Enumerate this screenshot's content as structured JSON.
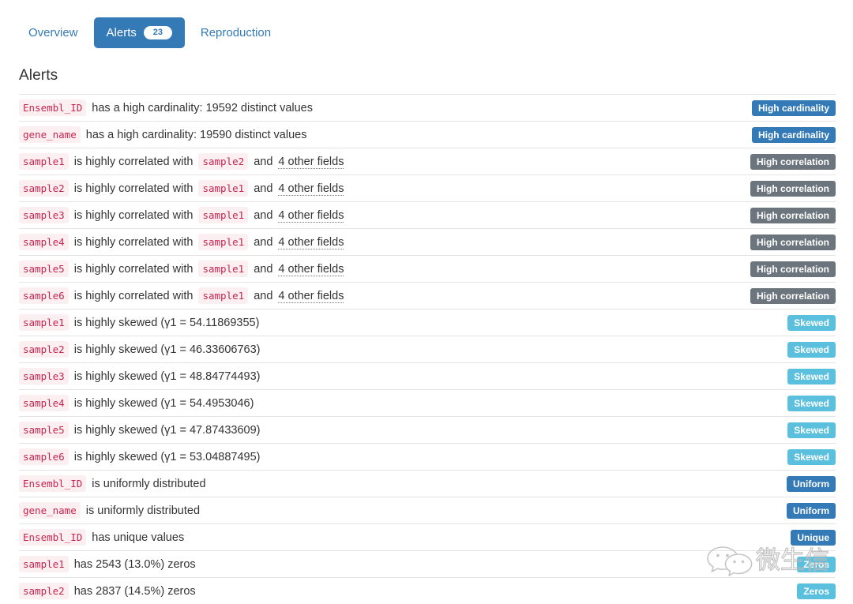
{
  "tabs": [
    {
      "label": "Overview",
      "active": false,
      "count": null
    },
    {
      "label": "Alerts",
      "active": true,
      "count": "23"
    },
    {
      "label": "Reproduction",
      "active": false,
      "count": null
    }
  ],
  "section": {
    "title": "Alerts"
  },
  "colors": {
    "accent": "#337ab7",
    "badge_primary": "#337ab7",
    "badge_secondary": "#6c757d",
    "badge_info": "#5bc0de",
    "code_text": "#c7254e",
    "code_bg": "#fbeff2",
    "row_border": "#e4e4e4"
  },
  "alerts": [
    {
      "parts": [
        {
          "type": "code",
          "text": "Ensembl_ID"
        },
        {
          "type": "text",
          "text": "has a high cardinality: 19592 distinct values"
        }
      ],
      "badge": {
        "label": "High cardinality",
        "style": "badge-primary"
      }
    },
    {
      "parts": [
        {
          "type": "code",
          "text": "gene_name"
        },
        {
          "type": "text",
          "text": "has a high cardinality: 19590 distinct values"
        }
      ],
      "badge": {
        "label": "High cardinality",
        "style": "badge-primary"
      }
    },
    {
      "parts": [
        {
          "type": "code",
          "text": "sample1"
        },
        {
          "type": "text",
          "text": "is highly correlated with"
        },
        {
          "type": "code",
          "text": "sample2"
        },
        {
          "type": "text",
          "text": "and"
        },
        {
          "type": "abbr",
          "text": "4 other fields"
        }
      ],
      "badge": {
        "label": "High correlation",
        "style": "badge-secondary"
      }
    },
    {
      "parts": [
        {
          "type": "code",
          "text": "sample2"
        },
        {
          "type": "text",
          "text": "is highly correlated with"
        },
        {
          "type": "code",
          "text": "sample1"
        },
        {
          "type": "text",
          "text": "and"
        },
        {
          "type": "abbr",
          "text": "4 other fields"
        }
      ],
      "badge": {
        "label": "High correlation",
        "style": "badge-secondary"
      }
    },
    {
      "parts": [
        {
          "type": "code",
          "text": "sample3"
        },
        {
          "type": "text",
          "text": "is highly correlated with"
        },
        {
          "type": "code",
          "text": "sample1"
        },
        {
          "type": "text",
          "text": "and"
        },
        {
          "type": "abbr",
          "text": "4 other fields"
        }
      ],
      "badge": {
        "label": "High correlation",
        "style": "badge-secondary"
      }
    },
    {
      "parts": [
        {
          "type": "code",
          "text": "sample4"
        },
        {
          "type": "text",
          "text": "is highly correlated with"
        },
        {
          "type": "code",
          "text": "sample1"
        },
        {
          "type": "text",
          "text": "and"
        },
        {
          "type": "abbr",
          "text": "4 other fields"
        }
      ],
      "badge": {
        "label": "High correlation",
        "style": "badge-secondary"
      }
    },
    {
      "parts": [
        {
          "type": "code",
          "text": "sample5"
        },
        {
          "type": "text",
          "text": "is highly correlated with"
        },
        {
          "type": "code",
          "text": "sample1"
        },
        {
          "type": "text",
          "text": "and"
        },
        {
          "type": "abbr",
          "text": "4 other fields"
        }
      ],
      "badge": {
        "label": "High correlation",
        "style": "badge-secondary"
      }
    },
    {
      "parts": [
        {
          "type": "code",
          "text": "sample6"
        },
        {
          "type": "text",
          "text": "is highly correlated with"
        },
        {
          "type": "code",
          "text": "sample1"
        },
        {
          "type": "text",
          "text": "and"
        },
        {
          "type": "abbr",
          "text": "4 other fields"
        }
      ],
      "badge": {
        "label": "High correlation",
        "style": "badge-secondary"
      }
    },
    {
      "parts": [
        {
          "type": "code",
          "text": "sample1"
        },
        {
          "type": "text",
          "text": "is highly skewed (γ1 = 54.11869355)"
        }
      ],
      "badge": {
        "label": "Skewed",
        "style": "badge-info"
      }
    },
    {
      "parts": [
        {
          "type": "code",
          "text": "sample2"
        },
        {
          "type": "text",
          "text": "is highly skewed (γ1 = 46.33606763)"
        }
      ],
      "badge": {
        "label": "Skewed",
        "style": "badge-info"
      }
    },
    {
      "parts": [
        {
          "type": "code",
          "text": "sample3"
        },
        {
          "type": "text",
          "text": "is highly skewed (γ1 = 48.84774493)"
        }
      ],
      "badge": {
        "label": "Skewed",
        "style": "badge-info"
      }
    },
    {
      "parts": [
        {
          "type": "code",
          "text": "sample4"
        },
        {
          "type": "text",
          "text": "is highly skewed (γ1 = 54.4953046)"
        }
      ],
      "badge": {
        "label": "Skewed",
        "style": "badge-info"
      }
    },
    {
      "parts": [
        {
          "type": "code",
          "text": "sample5"
        },
        {
          "type": "text",
          "text": "is highly skewed (γ1 = 47.87433609)"
        }
      ],
      "badge": {
        "label": "Skewed",
        "style": "badge-info"
      }
    },
    {
      "parts": [
        {
          "type": "code",
          "text": "sample6"
        },
        {
          "type": "text",
          "text": "is highly skewed (γ1 = 53.04887495)"
        }
      ],
      "badge": {
        "label": "Skewed",
        "style": "badge-info"
      }
    },
    {
      "parts": [
        {
          "type": "code",
          "text": "Ensembl_ID"
        },
        {
          "type": "text",
          "text": "is uniformly distributed"
        }
      ],
      "badge": {
        "label": "Uniform",
        "style": "badge-primary"
      }
    },
    {
      "parts": [
        {
          "type": "code",
          "text": "gene_name"
        },
        {
          "type": "text",
          "text": "is uniformly distributed"
        }
      ],
      "badge": {
        "label": "Uniform",
        "style": "badge-primary"
      }
    },
    {
      "parts": [
        {
          "type": "code",
          "text": "Ensembl_ID"
        },
        {
          "type": "text",
          "text": "has unique values"
        }
      ],
      "badge": {
        "label": "Unique",
        "style": "badge-primary"
      }
    },
    {
      "parts": [
        {
          "type": "code",
          "text": "sample1"
        },
        {
          "type": "text",
          "text": "has 2543 (13.0%) zeros"
        }
      ],
      "badge": {
        "label": "Zeros",
        "style": "badge-info"
      }
    },
    {
      "parts": [
        {
          "type": "code",
          "text": "sample2"
        },
        {
          "type": "text",
          "text": "has 2837 (14.5%) zeros"
        }
      ],
      "badge": {
        "label": "Zeros",
        "style": "badge-info"
      }
    }
  ],
  "watermark": {
    "text": "微生信",
    "logo": "wechat-icon"
  }
}
